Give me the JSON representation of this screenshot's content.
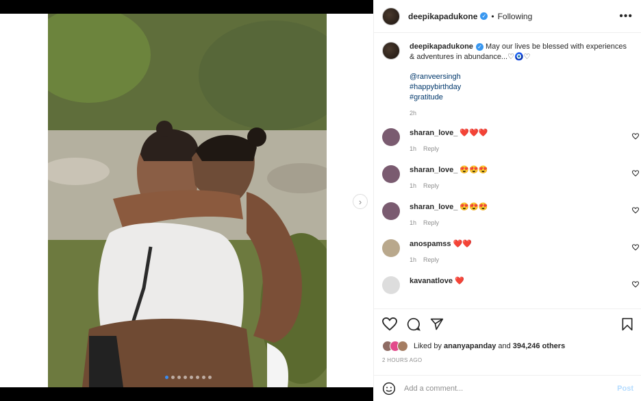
{
  "post": {
    "username": "deepikapadukone",
    "follow_status": "Following",
    "separator": "•",
    "more_glyph": "•••",
    "verified_glyph": "✓"
  },
  "caption": {
    "username": "deepikapadukone",
    "text": "May our lives be blessed with experiences & adventures in abundance...♡🧿♡",
    "mentions": [
      "@ranveersingh",
      "#happybirthday",
      "#gratitude"
    ],
    "time": "2h"
  },
  "comments": [
    {
      "username": "sharan_love_",
      "text": "❤️❤️❤️",
      "time": "1h",
      "reply": "Reply",
      "avatar_color": "#7a5b70"
    },
    {
      "username": "sharan_love_",
      "text": "😍😍😍",
      "time": "1h",
      "reply": "Reply",
      "avatar_color": "#7a5b70"
    },
    {
      "username": "sharan_love_",
      "text": "😍😍😍",
      "time": "1h",
      "reply": "Reply",
      "avatar_color": "#7a5b70"
    },
    {
      "username": "anospamss",
      "text": "❤️❤️",
      "time": "1h",
      "reply": "Reply",
      "avatar_color": "#b9a88c"
    },
    {
      "username": "kavanatlove",
      "text": "❤️",
      "time": "",
      "reply": "",
      "avatar_color": "#dddddd"
    }
  ],
  "likes": {
    "prefix": "Liked by",
    "user": "ananyapanday",
    "joiner": "and",
    "count": "394,246 others"
  },
  "posted_ago": "2 HOURS AGO",
  "comment_box": {
    "placeholder": "Add a comment...",
    "post_label": "Post"
  },
  "carousel": {
    "slide_count": 8,
    "active_index": 0,
    "next_glyph": "›"
  },
  "colors": {
    "link": "#00376b",
    "meta": "#8e8e8e",
    "text": "#262626",
    "verified": "#3897f0",
    "post_button": "#b3dbff",
    "active_dot": "#3a8cf0"
  }
}
